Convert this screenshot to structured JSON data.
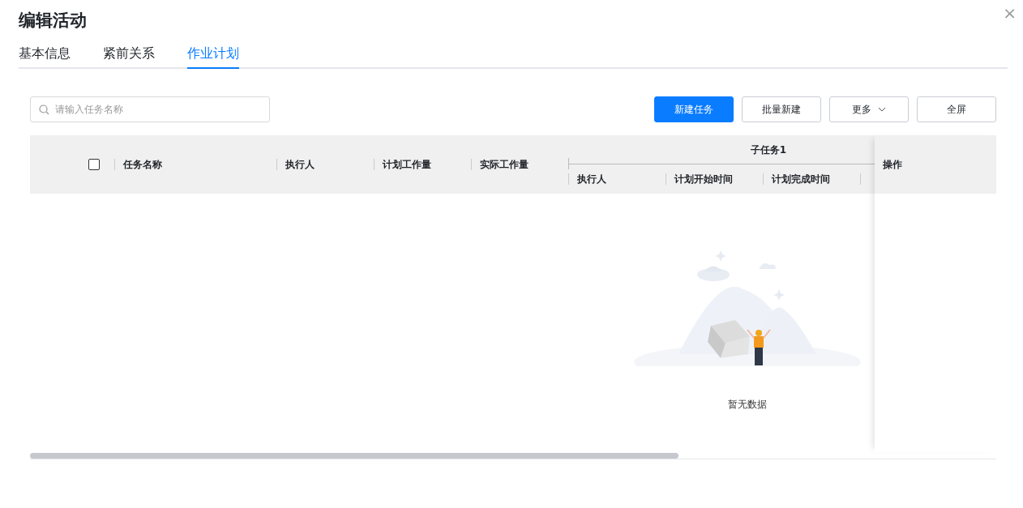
{
  "dialog": {
    "title": "编辑活动",
    "close": "×"
  },
  "tabs": [
    {
      "label": "基本信息",
      "selected": false
    },
    {
      "label": "紧前关系",
      "selected": false
    },
    {
      "label": "作业计划",
      "selected": true
    }
  ],
  "search": {
    "placeholder": "请输入任务名称"
  },
  "buttons": [
    {
      "label": "新建任务",
      "kind": "primary"
    },
    {
      "label": "批量新建",
      "kind": "default"
    },
    {
      "label": "更多",
      "kind": "dropdown"
    },
    {
      "label": "全屏",
      "kind": "default"
    }
  ],
  "table": {
    "select_all": {
      "checked": false
    },
    "columns": [
      "任务名称",
      "执行人",
      "计划工作量",
      "实际工作量"
    ],
    "group": {
      "title": "子任务1",
      "columns": [
        "执行人",
        "计划开始时间",
        "计划完成时间"
      ]
    },
    "action_column": "操作",
    "empty_text": "暂无数据"
  }
}
